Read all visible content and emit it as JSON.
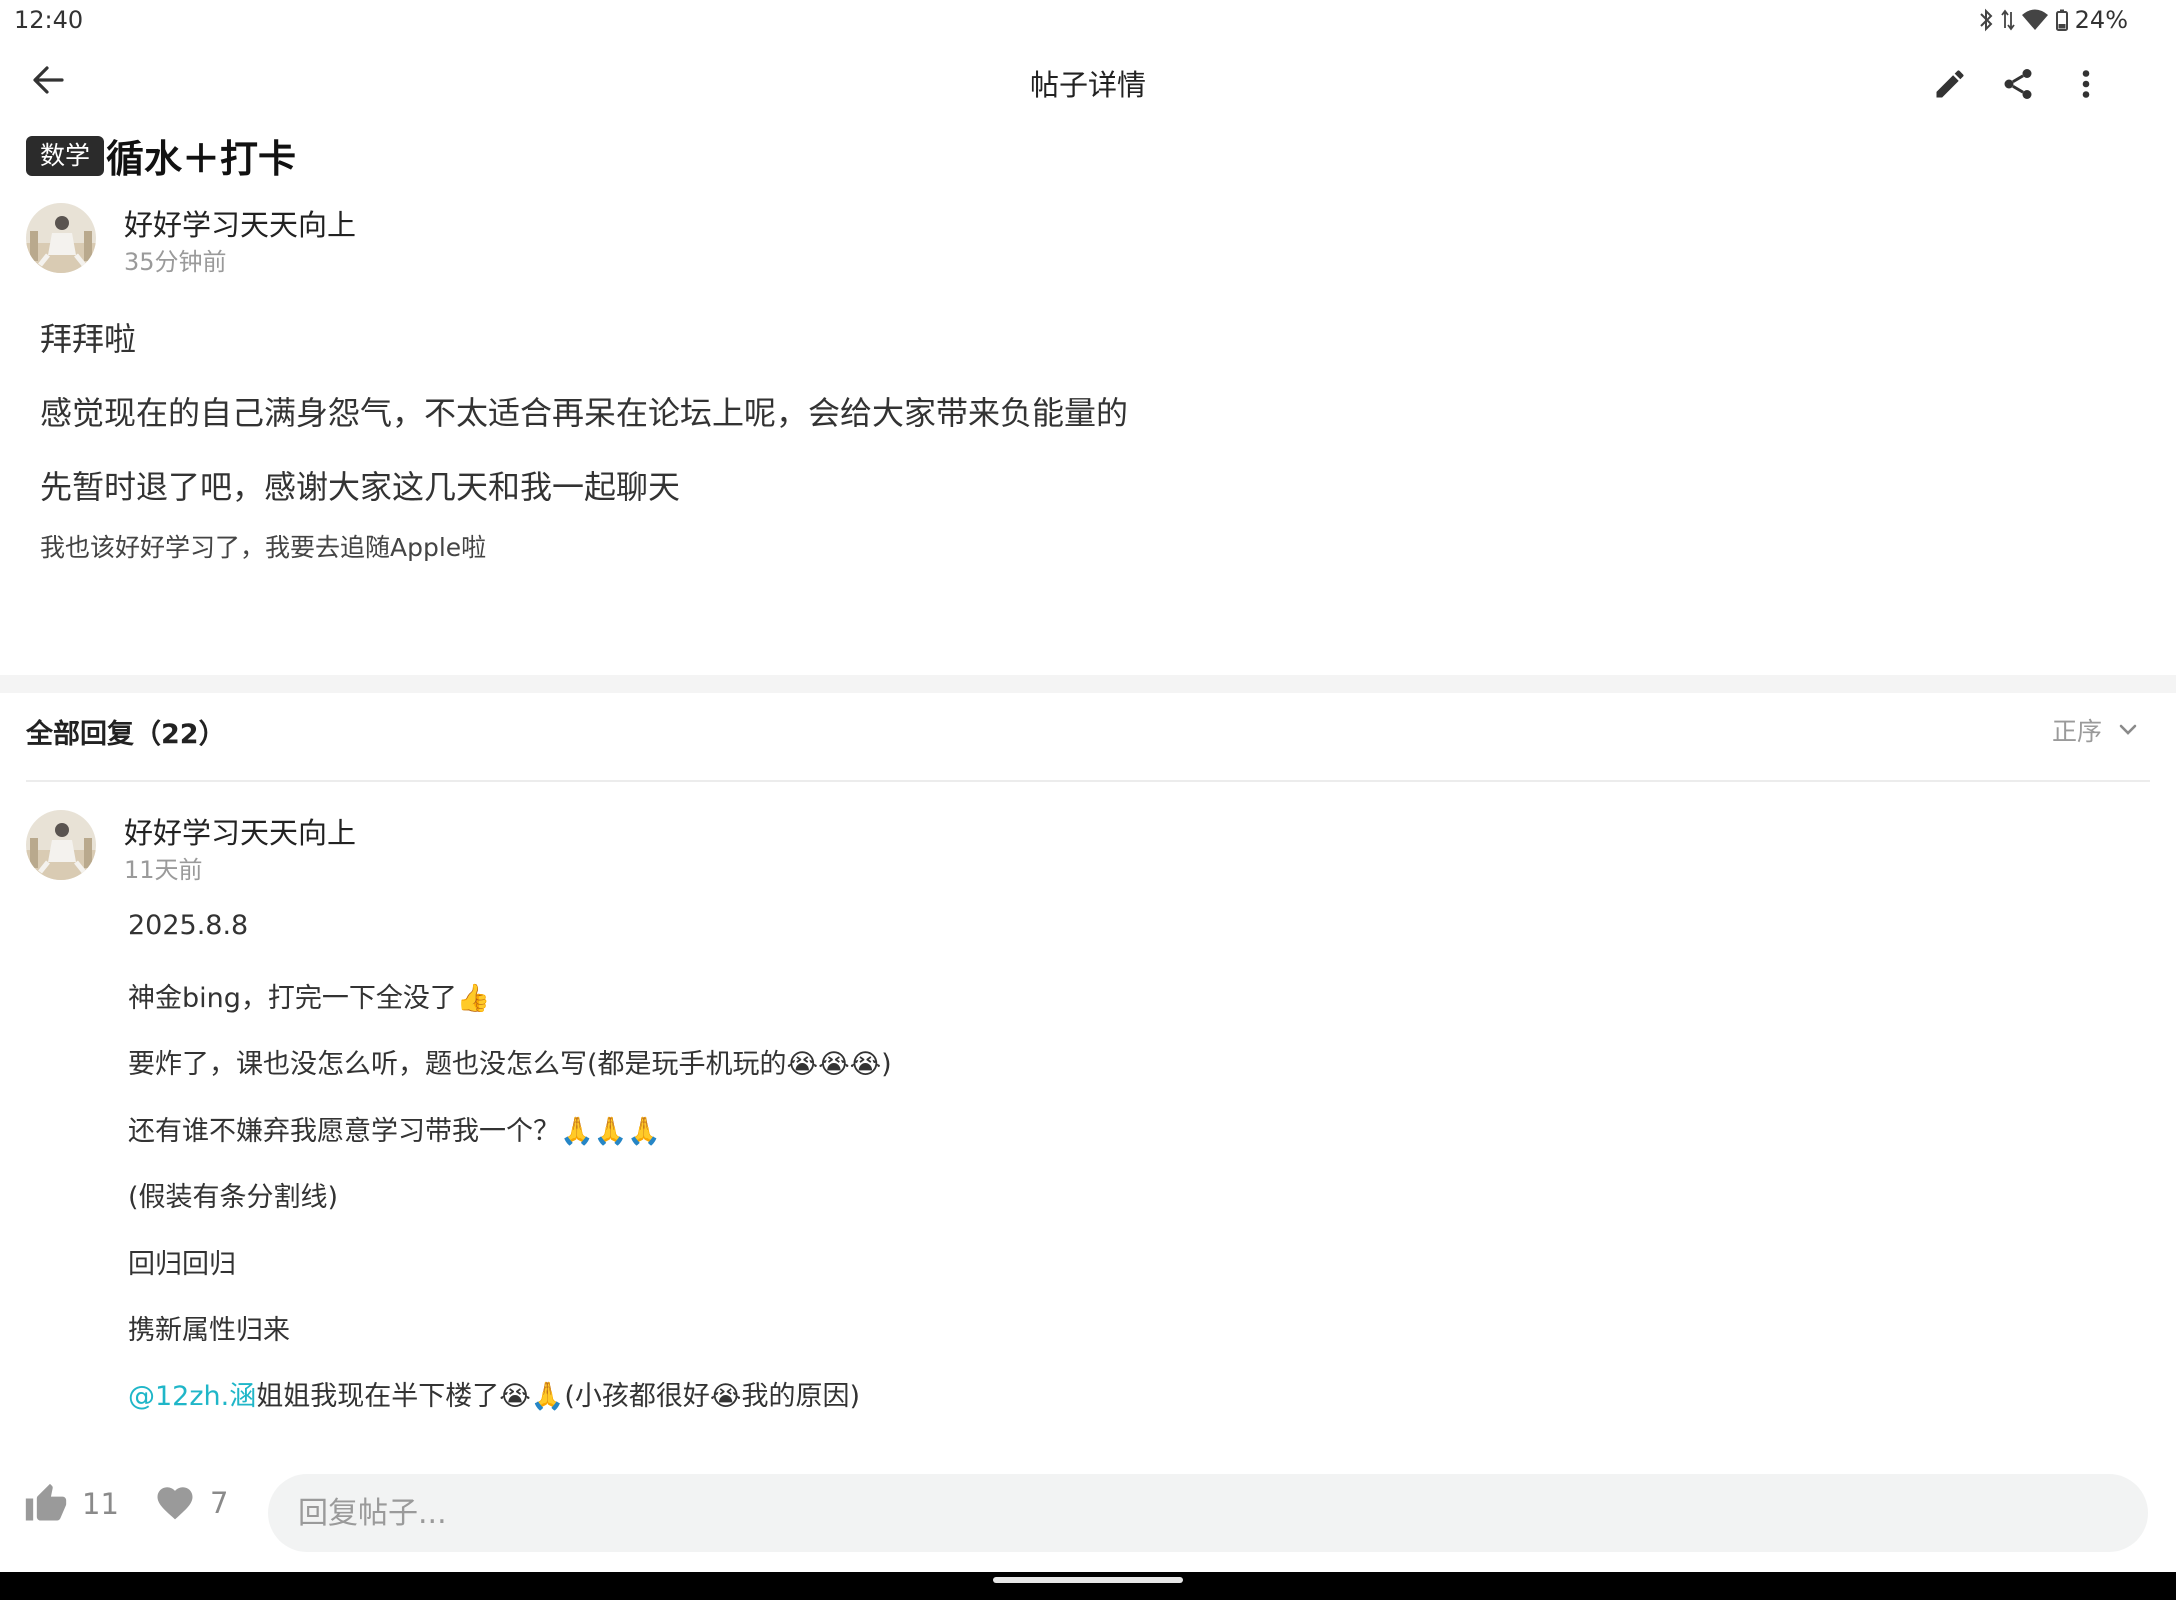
{
  "status_bar": {
    "time": "12:40",
    "battery": "24%",
    "icons": [
      "bluetooth-icon",
      "data-arrows-icon",
      "wifi-icon",
      "battery-icon"
    ]
  },
  "header": {
    "title": "帖子详情",
    "icons": [
      "back-arrow-icon",
      "edit-icon",
      "share-icon",
      "more-vertical-icon"
    ]
  },
  "post": {
    "tag": "数学",
    "title": "循水＋打卡",
    "author": "好好学习天天向上",
    "time": "35分钟前",
    "lines": [
      "拜拜啦",
      "感觉现在的自己满身怨气，不太适合再呆在论坛上呢，会给大家带来负能量的",
      "先暂时退了吧，感谢大家这几天和我一起聊天"
    ],
    "small_note": "我也该好好学习了，我要去追随Apple啦"
  },
  "replies": {
    "title": "全部回复（22）",
    "sort_label": "正序",
    "items": [
      {
        "author": "好好学习天天向上",
        "time": "11天前",
        "lines": [
          "2025.8.8",
          "神金bing，打完一下全没了👍",
          "要炸了，课也没怎么听，题也没怎么写(都是玩手机玩的😭😭😭)",
          "还有谁不嫌弃我愿意学习带我一个？🙏🙏🙏",
          "(假装有条分割线)",
          "回归回归",
          "携新属性归来"
        ],
        "mention": "@12zh.涵",
        "mention_rest": "姐姐我现在半下楼了😭🙏(小孩都很好😭我的原因)"
      }
    ]
  },
  "bottom_bar": {
    "like_count": "11",
    "favorite_count": "7",
    "reply_placeholder": "回复帖子..."
  },
  "colors": {
    "accent_mention": "#1fb6c8",
    "tag_background": "#2b2b2b",
    "muted_text": "#9a9a9a"
  }
}
